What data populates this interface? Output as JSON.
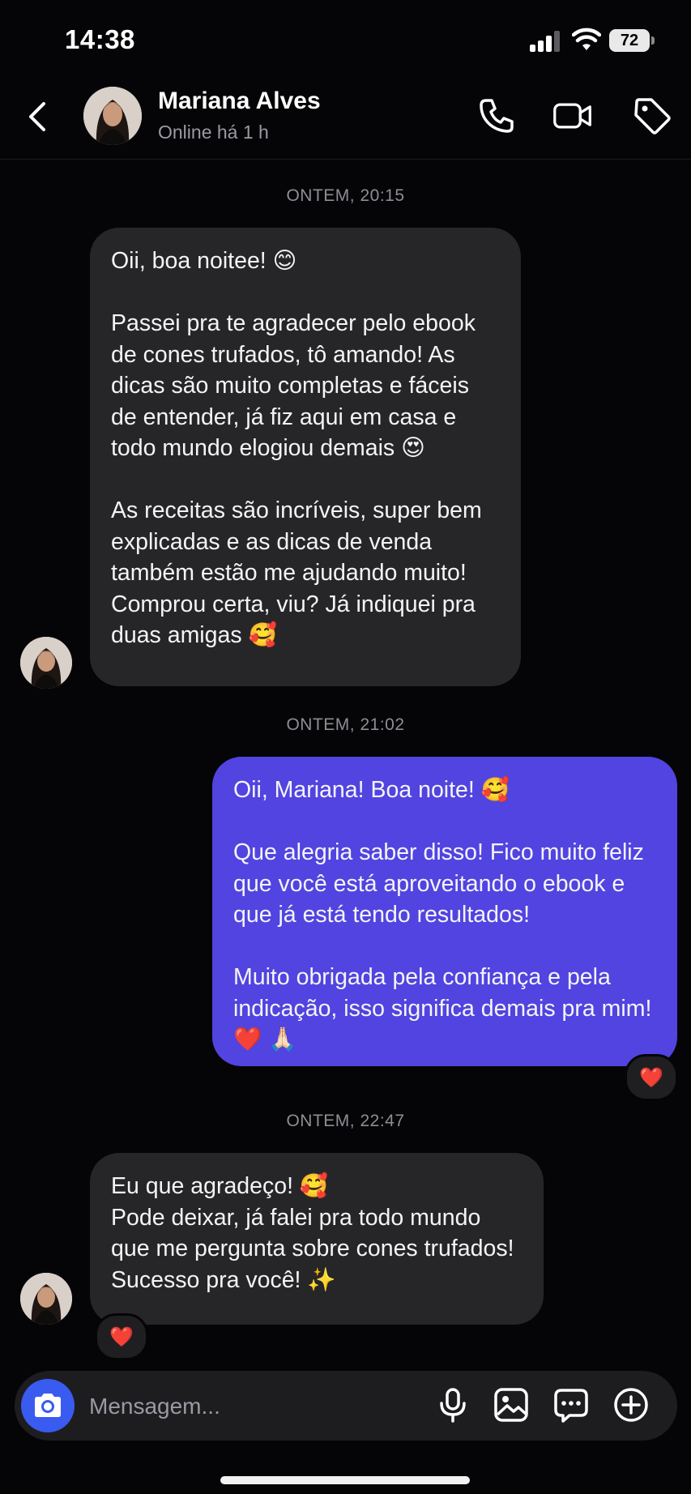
{
  "status_bar": {
    "time": "14:38",
    "battery": "72"
  },
  "header": {
    "name": "Mariana Alves",
    "status": "Online há 1 h",
    "icons": [
      "back-chevron-icon",
      "phone-icon",
      "video-camera-icon",
      "tag-icon"
    ]
  },
  "messages": [
    {
      "timestamp": "ONTEM, 20:15",
      "direction": "incoming",
      "text": "Oii, boa noitee! 😊\n\nPassei pra te agradecer pelo ebook de cones trufados, tô amando! As dicas são muito completas e fáceis de entender, já fiz aqui em casa e todo mundo elogiou demais 😍\n\nAs receitas são incríveis, super bem explicadas e as dicas de venda também estão me ajudando muito! Comprou certa, viu? Já indiquei pra duas amigas 🥰"
    },
    {
      "timestamp": "ONTEM, 21:02",
      "direction": "outgoing",
      "text": "Oii, Mariana! Boa noite! 🥰\n\nQue alegria saber disso! Fico muito feliz que você está aproveitando o ebook e que já está tendo resultados!\n\nMuito obrigada pela confiança e pela indicação, isso significa demais pra mim! ❤️ 🙏🏻",
      "reaction": "❤️"
    },
    {
      "timestamp": "ONTEM, 22:47",
      "direction": "incoming",
      "text": "Eu que agradeço! 🥰\nPode deixar, já falei pra  todo mundo que me pergunta sobre cones trufados! Sucesso pra você! ✨",
      "reaction": "❤️"
    }
  ],
  "composer": {
    "placeholder": "Mensagem...",
    "icons": [
      "camera-icon",
      "microphone-icon",
      "gallery-icon",
      "sticker-icon",
      "plus-icon"
    ]
  },
  "colors": {
    "background": "#050507",
    "incoming_bubble": "#262629",
    "outgoing_bubble": "#5144e0",
    "camera_button": "#3a5bf0"
  }
}
